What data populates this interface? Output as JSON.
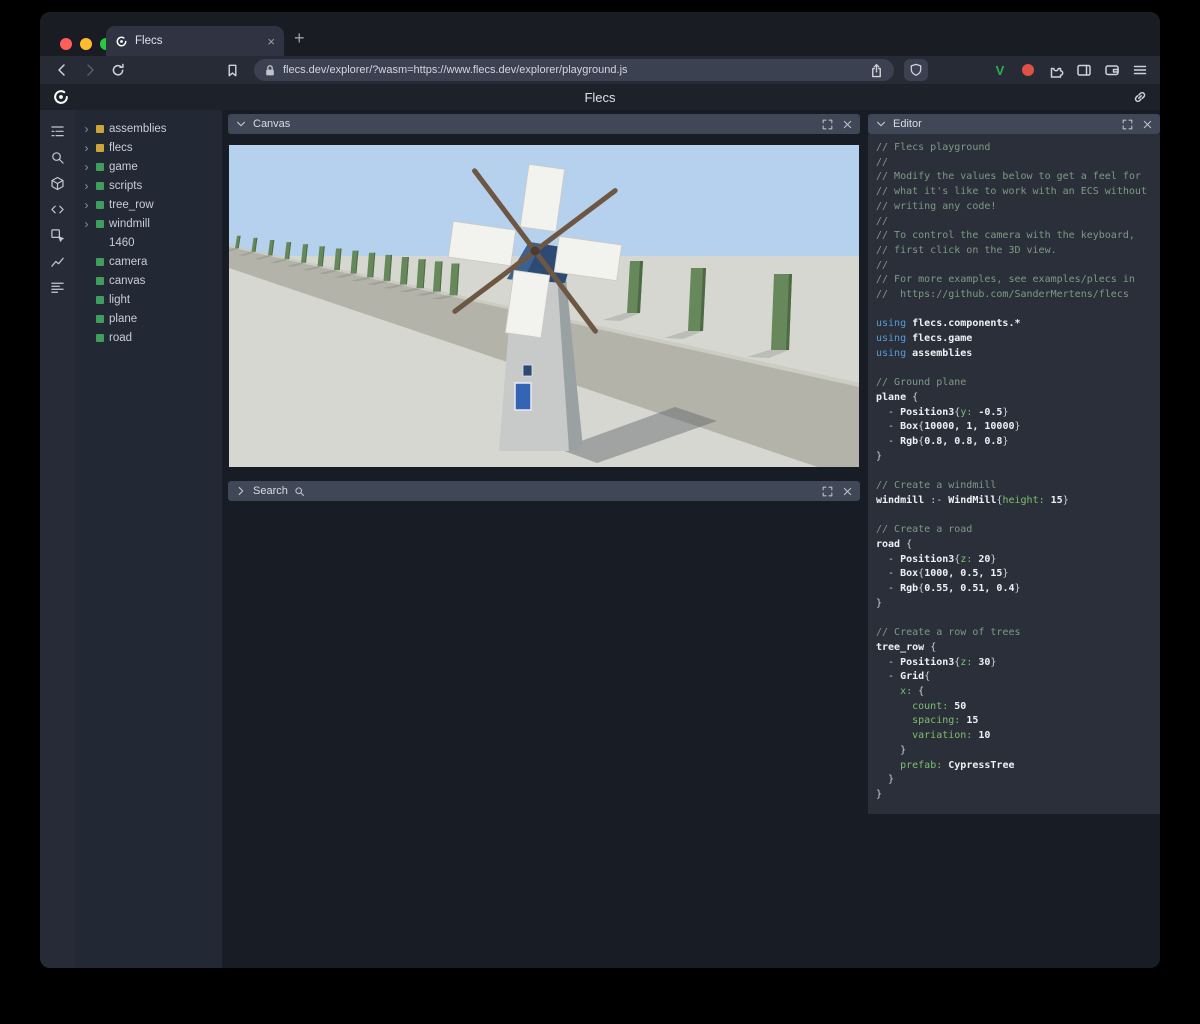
{
  "browser": {
    "tab_title": "Flecs",
    "new_tab_label": "+",
    "close_tab_label": "×",
    "url": "flecs.dev/explorer/?wasm=https://www.flecs.dev/explorer/playground.js",
    "traffic_lights": [
      "#ff5f57",
      "#febc2e",
      "#28c840"
    ],
    "toolbar_right": [
      {
        "name": "v-extension-icon",
        "glyph": "V",
        "color": "#2fae54"
      },
      {
        "name": "rewards-extension-icon",
        "dot": "#dd5244"
      },
      {
        "name": "puzzle-icon"
      },
      {
        "name": "sidebar-icon"
      },
      {
        "name": "wallet-icon"
      },
      {
        "name": "menu-icon"
      }
    ]
  },
  "app": {
    "title": "Flecs"
  },
  "rail": {
    "icons": [
      "outliner-icon",
      "search-icon",
      "cube-icon",
      "code-icon",
      "inspect-icon",
      "chart-icon",
      "list-icon"
    ]
  },
  "tree": {
    "items": [
      {
        "label": "assemblies",
        "color": "#c9a53a",
        "chevron": true
      },
      {
        "label": "flecs",
        "color": "#c9a53a",
        "chevron": true
      },
      {
        "label": "game",
        "color": "#3f9d5e",
        "chevron": true
      },
      {
        "label": "scripts",
        "color": "#3f9d5e",
        "chevron": true
      },
      {
        "label": "tree_row",
        "color": "#3f9d5e",
        "chevron": true
      },
      {
        "label": "windmill",
        "color": "#3f9d5e",
        "chevron": true
      },
      {
        "label": "1460",
        "color": null,
        "chevron": false
      },
      {
        "label": "camera",
        "color": "#3f9d5e",
        "chevron": false
      },
      {
        "label": "canvas",
        "color": "#3f9d5e",
        "chevron": false
      },
      {
        "label": "light",
        "color": "#3f9d5e",
        "chevron": false
      },
      {
        "label": "plane",
        "color": "#3f9d5e",
        "chevron": false
      },
      {
        "label": "road",
        "color": "#3f9d5e",
        "chevron": false
      }
    ]
  },
  "panels": {
    "canvas": {
      "title": "Canvas"
    },
    "search": {
      "title": "Search"
    },
    "editor": {
      "title": "Editor"
    }
  },
  "scene": {
    "sky": "#b6d1ee",
    "ground": "#d6d7d1",
    "road": "#b3b3a9",
    "road_edge": "#cbccc2",
    "tree": "#66885a",
    "tree_dark": "#4e6a44",
    "blade": "#f2f3ef",
    "beam": "#6d5742",
    "body": "#c7cac8",
    "body_shade": "#9aa1a2",
    "roof": "#2c4a74",
    "roof_light": "#3c6191",
    "door": "#3465b5",
    "shadow": "rgba(95,100,105,0.45)"
  },
  "editor": {
    "lines": [
      [
        [
          "c",
          "// Flecs playground"
        ]
      ],
      [
        [
          "c",
          "//"
        ]
      ],
      [
        [
          "c",
          "// Modify the values below to get a feel for"
        ]
      ],
      [
        [
          "c",
          "// what it's like to work with an ECS without"
        ]
      ],
      [
        [
          "c",
          "// writing any code!"
        ]
      ],
      [
        [
          "c",
          "//"
        ]
      ],
      [
        [
          "c",
          "// To control the camera with the keyboard,"
        ]
      ],
      [
        [
          "c",
          "// first click on the 3D view."
        ]
      ],
      [
        [
          "c",
          "//"
        ]
      ],
      [
        [
          "c",
          "// For more examples, see examples/plecs in"
        ]
      ],
      [
        [
          "c",
          "//  https://github.com/SanderMertens/flecs"
        ]
      ],
      [],
      [
        [
          "k",
          "using "
        ],
        [
          "b",
          "flecs.components.*"
        ]
      ],
      [
        [
          "k",
          "using "
        ],
        [
          "b",
          "flecs.game"
        ]
      ],
      [
        [
          "k",
          "using "
        ],
        [
          "b",
          "assemblies"
        ]
      ],
      [],
      [
        [
          "c",
          "// Ground plane"
        ]
      ],
      [
        [
          "b",
          "plane"
        ],
        [
          "t",
          " {"
        ]
      ],
      [
        [
          "t",
          "  - "
        ],
        [
          "b",
          "Position3"
        ],
        [
          "t",
          "{"
        ],
        [
          "p",
          "y: "
        ],
        [
          "b",
          "-0.5"
        ],
        [
          "t",
          "}"
        ]
      ],
      [
        [
          "t",
          "  - "
        ],
        [
          "b",
          "Box"
        ],
        [
          "t",
          "{"
        ],
        [
          "b",
          "10000, 1, 10000"
        ],
        [
          "t",
          "}"
        ]
      ],
      [
        [
          "t",
          "  - "
        ],
        [
          "b",
          "Rgb"
        ],
        [
          "t",
          "{"
        ],
        [
          "b",
          "0.8, 0.8, 0.8"
        ],
        [
          "t",
          "}"
        ]
      ],
      [
        [
          "t",
          "}"
        ]
      ],
      [],
      [
        [
          "c",
          "// Create a windmill"
        ]
      ],
      [
        [
          "b",
          "windmill"
        ],
        [
          "t",
          " :- "
        ],
        [
          "b",
          "WindMill"
        ],
        [
          "t",
          "{"
        ],
        [
          "p",
          "height: "
        ],
        [
          "b",
          "15"
        ],
        [
          "t",
          "}"
        ]
      ],
      [],
      [
        [
          "c",
          "// Create a road"
        ]
      ],
      [
        [
          "b",
          "road"
        ],
        [
          "t",
          " {"
        ]
      ],
      [
        [
          "t",
          "  - "
        ],
        [
          "b",
          "Position3"
        ],
        [
          "t",
          "{"
        ],
        [
          "p",
          "z: "
        ],
        [
          "b",
          "20"
        ],
        [
          "t",
          "}"
        ]
      ],
      [
        [
          "t",
          "  - "
        ],
        [
          "b",
          "Box"
        ],
        [
          "t",
          "{"
        ],
        [
          "b",
          "1000, 0.5, 15"
        ],
        [
          "t",
          "}"
        ]
      ],
      [
        [
          "t",
          "  - "
        ],
        [
          "b",
          "Rgb"
        ],
        [
          "t",
          "{"
        ],
        [
          "b",
          "0.55, 0.51, 0.4"
        ],
        [
          "t",
          "}"
        ]
      ],
      [
        [
          "t",
          "}"
        ]
      ],
      [],
      [
        [
          "c",
          "// Create a row of trees"
        ]
      ],
      [
        [
          "b",
          "tree_row"
        ],
        [
          "t",
          " {"
        ]
      ],
      [
        [
          "t",
          "  - "
        ],
        [
          "b",
          "Position3"
        ],
        [
          "t",
          "{"
        ],
        [
          "p",
          "z: "
        ],
        [
          "b",
          "30"
        ],
        [
          "t",
          "}"
        ]
      ],
      [
        [
          "t",
          "  - "
        ],
        [
          "b",
          "Grid"
        ],
        [
          "t",
          "{"
        ]
      ],
      [
        [
          "t",
          "    "
        ],
        [
          "p",
          "x: "
        ],
        [
          "t",
          "{"
        ]
      ],
      [
        [
          "t",
          "      "
        ],
        [
          "p",
          "count: "
        ],
        [
          "b",
          "50"
        ]
      ],
      [
        [
          "t",
          "      "
        ],
        [
          "p",
          "spacing: "
        ],
        [
          "b",
          "15"
        ]
      ],
      [
        [
          "t",
          "      "
        ],
        [
          "p",
          "variation: "
        ],
        [
          "b",
          "10"
        ]
      ],
      [
        [
          "t",
          "    }"
        ]
      ],
      [
        [
          "t",
          "    "
        ],
        [
          "p",
          "prefab: "
        ],
        [
          "b",
          "CypressTree"
        ]
      ],
      [
        [
          "t",
          "  }"
        ]
      ],
      [
        [
          "t",
          "}"
        ]
      ]
    ]
  }
}
